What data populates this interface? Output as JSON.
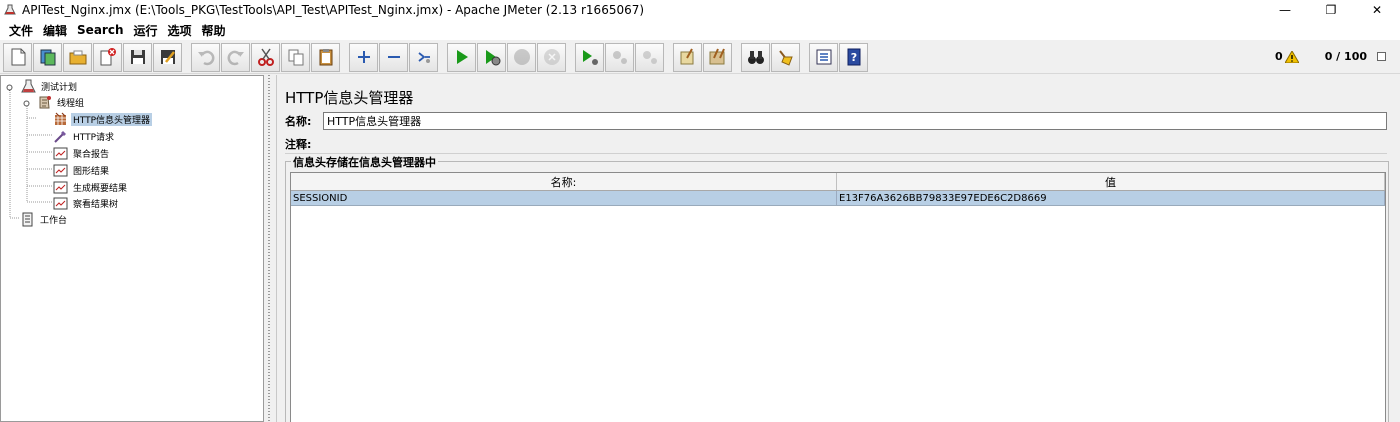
{
  "window": {
    "title": "APITest_Nginx.jmx (E:\\Tools_PKG\\TestTools\\API_Test\\APITest_Nginx.jmx) - Apache JMeter (2.13 r1665067)",
    "minimize_glyph": "—",
    "maximize_glyph": "❐",
    "close_glyph": "✕"
  },
  "menu": [
    "文件",
    "编辑",
    "Search",
    "运行",
    "选项",
    "帮助"
  ],
  "toolbar": {
    "warning_count": "0",
    "thread_ratio": "0 / 100",
    "buttons": [
      {
        "name": "new",
        "icon": "new-file-icon",
        "enabled": true
      },
      {
        "name": "templates",
        "icon": "templates-icon",
        "enabled": true
      },
      {
        "name": "open",
        "icon": "open-folder-icon",
        "enabled": true
      },
      {
        "name": "close",
        "icon": "close-file-icon",
        "enabled": true
      },
      {
        "name": "save",
        "icon": "save-icon",
        "enabled": true
      },
      {
        "name": "save-as-image",
        "icon": "save-as-icon",
        "enabled": true
      },
      {
        "name": "undo",
        "icon": "undo-icon",
        "enabled": false
      },
      {
        "name": "redo",
        "icon": "redo-icon",
        "enabled": false
      },
      {
        "name": "cut",
        "icon": "cut-icon",
        "enabled": true
      },
      {
        "name": "copy",
        "icon": "copy-icon",
        "enabled": true
      },
      {
        "name": "paste",
        "icon": "paste-icon",
        "enabled": true
      },
      {
        "name": "expand",
        "icon": "plus-icon",
        "enabled": true
      },
      {
        "name": "collapse",
        "icon": "minus-icon",
        "enabled": true
      },
      {
        "name": "toggle",
        "icon": "toggle-icon",
        "enabled": true
      },
      {
        "name": "start",
        "icon": "play-icon",
        "enabled": true
      },
      {
        "name": "start-no-pauses",
        "icon": "play-no-timer-icon",
        "enabled": true
      },
      {
        "name": "stop",
        "icon": "stop-icon",
        "enabled": false
      },
      {
        "name": "shutdown",
        "icon": "shutdown-icon",
        "enabled": false
      },
      {
        "name": "remote-start",
        "icon": "remote-start-icon",
        "enabled": true
      },
      {
        "name": "remote-stop",
        "icon": "remote-stop-icon",
        "enabled": false
      },
      {
        "name": "remote-shutdown",
        "icon": "remote-shutdown-icon",
        "enabled": false
      },
      {
        "name": "clear",
        "icon": "broom-icon",
        "enabled": true
      },
      {
        "name": "clear-all",
        "icon": "broom-all-icon",
        "enabled": true
      },
      {
        "name": "search",
        "icon": "binoculars-icon",
        "enabled": true
      },
      {
        "name": "reset-search",
        "icon": "reset-search-icon",
        "enabled": true
      },
      {
        "name": "function-helper",
        "icon": "function-list-icon",
        "enabled": true
      },
      {
        "name": "help",
        "icon": "help-icon",
        "enabled": true
      }
    ]
  },
  "tree": {
    "nodes": [
      {
        "label": "测试计划",
        "icon": "test-plan-icon",
        "selected": false
      },
      {
        "label": "线程组",
        "icon": "thread-group-icon",
        "selected": false
      },
      {
        "label": "HTTP信息头管理器",
        "icon": "header-manager-icon",
        "selected": true
      },
      {
        "label": "HTTP请求",
        "icon": "http-sampler-icon",
        "selected": false
      },
      {
        "label": "聚合报告",
        "icon": "listener-icon",
        "selected": false
      },
      {
        "label": "图形结果",
        "icon": "listener-icon",
        "selected": false
      },
      {
        "label": "生成概要结果",
        "icon": "listener-icon",
        "selected": false
      },
      {
        "label": "察看结果树",
        "icon": "listener-icon",
        "selected": false
      },
      {
        "label": "工作台",
        "icon": "workbench-icon",
        "selected": false
      }
    ]
  },
  "panel": {
    "title": "HTTP信息头管理器",
    "name_label": "名称:",
    "name_value": "HTTP信息头管理器",
    "comment_label": "注释:",
    "group_title": "信息头存储在信息头管理器中",
    "table": {
      "headers": [
        "名称:",
        "值"
      ],
      "rows": [
        [
          "SESSIONID",
          "E13F76A3626BB79833E97EDE6C2D8669"
        ]
      ]
    }
  },
  "colors": {
    "selection": "#b8cfe5",
    "play": "#1a9a1a",
    "warning": "#f0c000"
  }
}
